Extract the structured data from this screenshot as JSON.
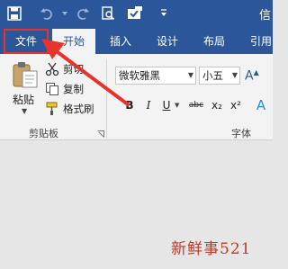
{
  "window": {
    "title": "信"
  },
  "tabs": [
    "文件",
    "开始",
    "插入",
    "设计",
    "布局",
    "引用"
  ],
  "clipboard": {
    "paste_label": "粘贴",
    "cut_label": "剪切",
    "copy_label": "复制",
    "format_painter_label": "格式刷",
    "group_label": "剪贴板"
  },
  "font": {
    "family_value": "微软雅黑",
    "size_value": "小五",
    "group_label": "字体",
    "format_buttons": [
      "B",
      "I",
      "U",
      "abc",
      "x₂",
      "x²",
      "A"
    ]
  },
  "watermark": "新鲜事521",
  "colors": {
    "ribbon_blue": "#2b579a",
    "highlight_red": "#e8322e"
  }
}
